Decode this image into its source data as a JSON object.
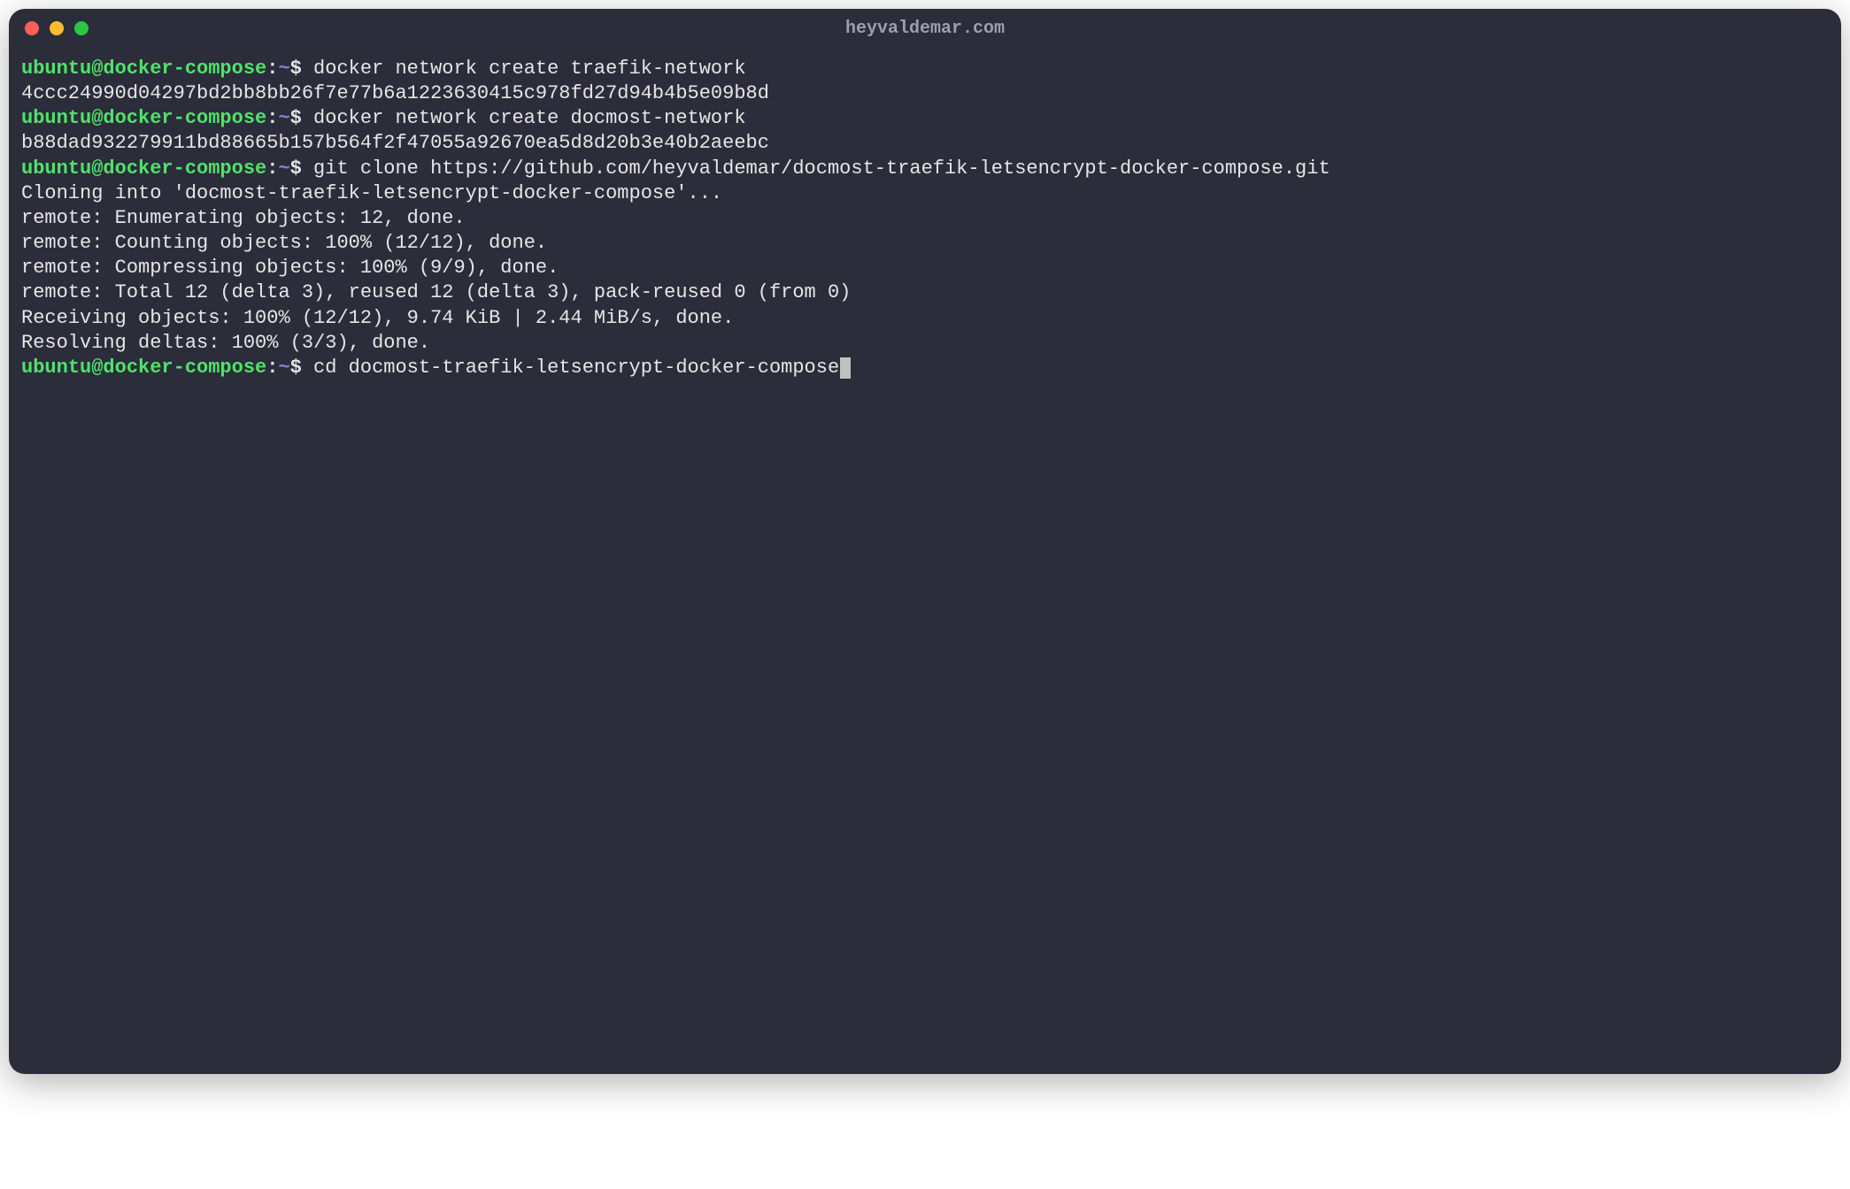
{
  "window": {
    "title": "heyvaldemar.com"
  },
  "prompt": {
    "userhost": "ubuntu@docker-compose",
    "colon": ":",
    "path": "~",
    "dollar": "$"
  },
  "lines": [
    {
      "type": "prompt",
      "cmd": "docker network create traefik-network"
    },
    {
      "type": "output",
      "text": "4ccc24990d04297bd2bb8bb26f7e77b6a1223630415c978fd27d94b4b5e09b8d"
    },
    {
      "type": "prompt",
      "cmd": "docker network create docmost-network"
    },
    {
      "type": "output",
      "text": "b88dad932279911bd88665b157b564f2f47055a92670ea5d8d20b3e40b2aeebc"
    },
    {
      "type": "prompt",
      "cmd": "git clone https://github.com/heyvaldemar/docmost-traefik-letsencrypt-docker-compose.git"
    },
    {
      "type": "output",
      "text": "Cloning into 'docmost-traefik-letsencrypt-docker-compose'..."
    },
    {
      "type": "output",
      "text": "remote: Enumerating objects: 12, done."
    },
    {
      "type": "output",
      "text": "remote: Counting objects: 100% (12/12), done."
    },
    {
      "type": "output",
      "text": "remote: Compressing objects: 100% (9/9), done."
    },
    {
      "type": "output",
      "text": "remote: Total 12 (delta 3), reused 12 (delta 3), pack-reused 0 (from 0)"
    },
    {
      "type": "output",
      "text": "Receiving objects: 100% (12/12), 9.74 KiB | 2.44 MiB/s, done."
    },
    {
      "type": "output",
      "text": "Resolving deltas: 100% (3/3), done."
    },
    {
      "type": "prompt",
      "cmd": "cd docmost-traefik-letsencrypt-docker-compose",
      "cursor": true
    }
  ]
}
